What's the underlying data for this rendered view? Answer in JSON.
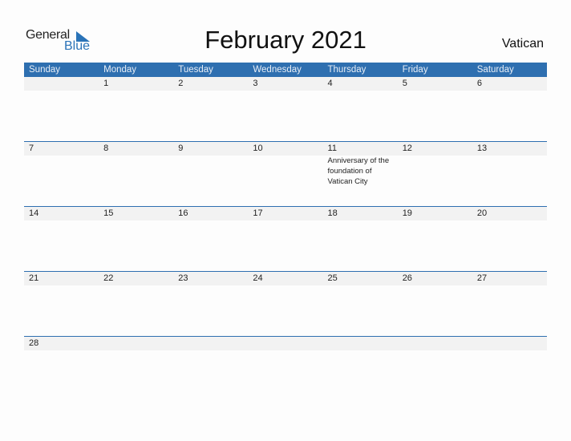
{
  "logo": {
    "general": "General",
    "blue": "Blue",
    "icon": "triangle-flag-icon"
  },
  "title": "February 2021",
  "country": "Vatican",
  "weekdays": [
    "Sunday",
    "Monday",
    "Tuesday",
    "Wednesday",
    "Thursday",
    "Friday",
    "Saturday"
  ],
  "colors": {
    "accent": "#2e6fb0",
    "date_strip": "#f2f2f2"
  },
  "weeks": [
    {
      "days": [
        "",
        "1",
        "2",
        "3",
        "4",
        "5",
        "6"
      ],
      "events": [
        "",
        "",
        "",
        "",
        "",
        "",
        ""
      ]
    },
    {
      "days": [
        "7",
        "8",
        "9",
        "10",
        "11",
        "12",
        "13"
      ],
      "events": [
        "",
        "",
        "",
        "",
        "Anniversary of the foundation of Vatican City",
        "",
        ""
      ]
    },
    {
      "days": [
        "14",
        "15",
        "16",
        "17",
        "18",
        "19",
        "20"
      ],
      "events": [
        "",
        "",
        "",
        "",
        "",
        "",
        ""
      ]
    },
    {
      "days": [
        "21",
        "22",
        "23",
        "24",
        "25",
        "26",
        "27"
      ],
      "events": [
        "",
        "",
        "",
        "",
        "",
        "",
        ""
      ]
    },
    {
      "days": [
        "28",
        "",
        "",
        "",
        "",
        "",
        ""
      ],
      "events": [
        "",
        "",
        "",
        "",
        "",
        "",
        ""
      ]
    }
  ]
}
